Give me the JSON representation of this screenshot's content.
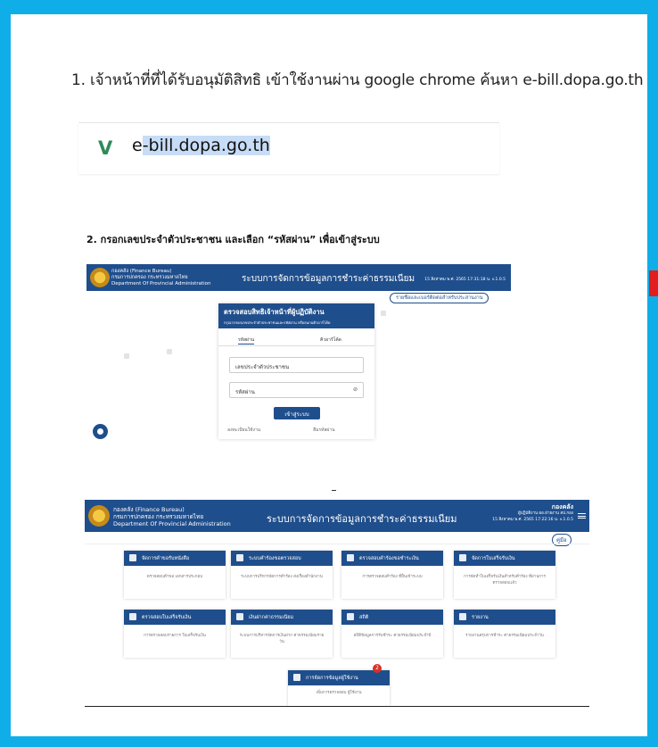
{
  "steps": {
    "step1": "1. เจ้าหน้าที่ที่ได้รับอนุมัติสิทธิ เข้าใช้งานผ่าน google chrome ค้นหา e-bill.dopa.go.th",
    "step2": "2. กรอกเลขประจำตัวประชาชน และเลือก “รหัสผ่าน” เพื่อเข้าสู่ระบบ"
  },
  "address_bar": {
    "url_prefix": "e",
    "url_selected": "-bill.dopa.go.th"
  },
  "system": {
    "org_line1": "กองคลัง (Finance Bureau)",
    "org_line2": "กรมการปกครอง กระทรวงมหาดไทย",
    "org_line3": "Department Of Provincial Administration",
    "title": "ระบบการจัดการข้อมูลการชำระค่าธรรมเนียม"
  },
  "login_screen": {
    "date": "15 สิงหาคม พ.ศ. 2565 17:31:18 น. v.1.0.5",
    "contact_link": "รายชื่อและเบอร์ติดต่อสำหรับประสานงาน",
    "card_title": "ตรวจสอบสิทธิเจ้าหน้าที่ผู้ปฏิบัติงาน",
    "card_subtitle": "กรุณากรอกเลขประจำตัวประชาชนและรหัสผ่าน หรือสแกนคิวอาร์โค้ด",
    "tab_password": "รหัสผ่าน",
    "tab_qr": "คิวอาร์โค้ด",
    "id_placeholder": "เลขประจำตัวประชาชน",
    "password_placeholder": "รหัสผ่าน",
    "eye_icon_glyph": "⊘",
    "login_button": "เข้าสู่ระบบ",
    "register_link": "ลงทะเบียนใช้งาน",
    "forgot_link": "ลืมรหัสผ่าน"
  },
  "dashboard": {
    "user_name": "กองคลัง",
    "user_role": "ผู้ปฏิบัติงาน ผอ.ฝ่ายงาน สป.กอง",
    "date": "15 สิงหาคม พ.ศ. 2565 17:22:16 น. v.1.0.5",
    "manual_button": "คู่มือ",
    "cards": [
      {
        "title": "จัดการคำขอรับหนังสือ",
        "desc": "ตรวจสอบคำขอ เอกสารประกอบ"
      },
      {
        "title": "ระบบคำร้องขอตรวจสอบ",
        "desc": "ระบบการบริหารจัดการคำร้อง ส่งเรื่องสำนักงาน"
      },
      {
        "title": "ตรวจสอบคำร้องขอชำระเงิน",
        "desc": "การตรวจสอบคำร้อง ที่ยื่นเข้าระบบ"
      },
      {
        "title": "จัดการใบเสร็จรับเงิน",
        "desc": "การจัดทำใบเสร็จรับเงินสำหรับคำร้อง ที่ผ่านการตรวจสอบแล้ว"
      },
      {
        "title": "ตรวจสอบใบเสร็จรับเงิน",
        "desc": "การตรวจสอบรายการ ใบเสร็จรับเงิน"
      },
      {
        "title": "เงินฝากค่าธรรมเนียม",
        "desc": "ระบบการบริหารจัดการเงินฝาก ค่าธรรมเนียมรายวัน"
      },
      {
        "title": "สถิติ",
        "desc": "สถิติข้อมูลการรับชำระ ค่าธรรมเนียมประจำปี"
      },
      {
        "title": "รายงาน",
        "desc": "รายงานสรุปการชำระ ค่าธรรมเนียมประจำวัน"
      }
    ],
    "extra_card": {
      "title": "การจัดการข้อมูลผู้ใช้งาน",
      "desc": "เพิ่มการตรวจสอบ ผู้ใช้งาน",
      "badge": "2"
    }
  },
  "colors": {
    "frame": "#10aee8",
    "primary": "#1f4e8c"
  }
}
